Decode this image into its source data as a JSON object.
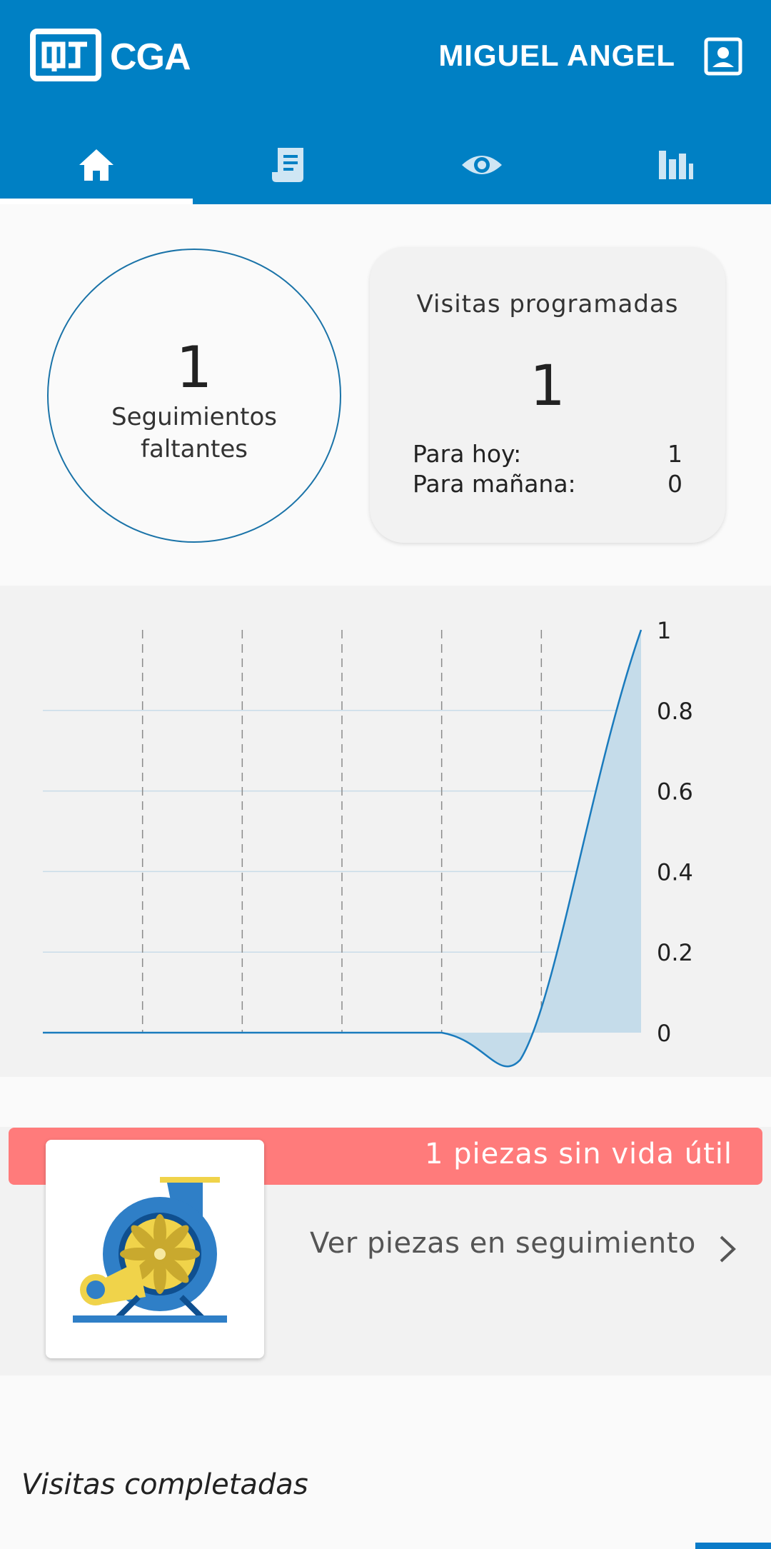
{
  "header": {
    "brand": "CGA",
    "username": "MIGUEL ANGEL",
    "colors": {
      "primary": "#0080c4"
    },
    "tabs": [
      {
        "icon": "home-icon",
        "active": true
      },
      {
        "icon": "receipt-icon",
        "active": false
      },
      {
        "icon": "eye-icon",
        "active": false
      },
      {
        "icon": "bar-chart-icon",
        "active": false
      }
    ]
  },
  "summary": {
    "seguimientos": {
      "value": "1",
      "label_line1": "Seguimientos",
      "label_line2": "faltantes"
    },
    "visitas": {
      "title": "Visitas programadas",
      "total": "1",
      "today_label": "Para hoy:",
      "today_value": "1",
      "tomorrow_label": "Para mañana:",
      "tomorrow_value": "0"
    }
  },
  "chart_data": {
    "type": "area",
    "x": [
      0,
      1,
      2,
      3,
      4,
      5,
      6
    ],
    "values": [
      0,
      0,
      0,
      0,
      0,
      0,
      1
    ],
    "ylim": [
      0,
      1
    ],
    "y_ticks": [
      "0",
      "0.2",
      "0.4",
      "0.6",
      "0.8",
      "1"
    ],
    "y_tick_values": [
      0,
      0.2,
      0.4,
      0.6,
      0.8,
      1
    ],
    "grid": true,
    "color": "#1a7bbd",
    "fill": "#c5dcea"
  },
  "alert": {
    "banner": "1 piezas sin vida útil",
    "banner_color": "#ff7b7b",
    "link": "Ver piezas en seguimiento",
    "image_icon": "turbine-fan-icon"
  },
  "completed": {
    "title": "Visitas completadas"
  }
}
